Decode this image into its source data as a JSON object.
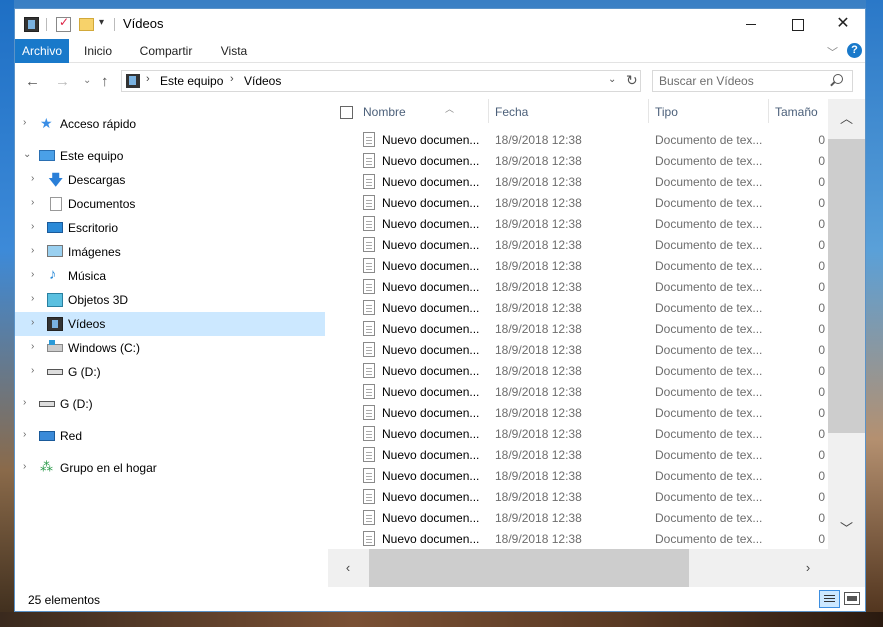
{
  "window": {
    "title": "Vídeos",
    "minimize_label": "",
    "maximize_label": "",
    "close_label": "✕"
  },
  "ribbon": {
    "tabs": [
      "Archivo",
      "Inicio",
      "Compartir",
      "Vista"
    ]
  },
  "address": {
    "crumbs": [
      "Este equipo",
      "Vídeos"
    ],
    "search_placeholder": "Buscar en Vídeos"
  },
  "nav_pane": {
    "items": [
      {
        "label": "Acceso rápido",
        "icon": "star-icon"
      },
      {
        "label": "Este equipo",
        "icon": "computer-icon"
      },
      {
        "label": "Descargas",
        "icon": "download-icon"
      },
      {
        "label": "Documentos",
        "icon": "document-icon"
      },
      {
        "label": "Escritorio",
        "icon": "desktop-icon"
      },
      {
        "label": "Imágenes",
        "icon": "image-icon"
      },
      {
        "label": "Música",
        "icon": "music-icon"
      },
      {
        "label": "Objetos 3D",
        "icon": "3d-objects-icon"
      },
      {
        "label": "Vídeos",
        "icon": "film-icon",
        "selected": true
      },
      {
        "label": "Windows (C:)",
        "icon": "drive-icon"
      },
      {
        "label": "G (D:)",
        "icon": "drive-icon"
      },
      {
        "label": "G (D:)",
        "icon": "drive-icon"
      },
      {
        "label": "Red",
        "icon": "network-icon"
      },
      {
        "label": "Grupo en el hogar",
        "icon": "homegroup-icon"
      }
    ]
  },
  "file_list": {
    "columns": [
      "Nombre",
      "Fecha",
      "Tipo",
      "Tamaño"
    ],
    "rows": [
      {
        "name": "Nuevo documen...",
        "date": "18/9/2018 12:38",
        "type": "Documento de tex...",
        "size": "0"
      },
      {
        "name": "Nuevo documen...",
        "date": "18/9/2018 12:38",
        "type": "Documento de tex...",
        "size": "0"
      },
      {
        "name": "Nuevo documen...",
        "date": "18/9/2018 12:38",
        "type": "Documento de tex...",
        "size": "0"
      },
      {
        "name": "Nuevo documen...",
        "date": "18/9/2018 12:38",
        "type": "Documento de tex...",
        "size": "0"
      },
      {
        "name": "Nuevo documen...",
        "date": "18/9/2018 12:38",
        "type": "Documento de tex...",
        "size": "0"
      },
      {
        "name": "Nuevo documen...",
        "date": "18/9/2018 12:38",
        "type": "Documento de tex...",
        "size": "0"
      },
      {
        "name": "Nuevo documen...",
        "date": "18/9/2018 12:38",
        "type": "Documento de tex...",
        "size": "0"
      },
      {
        "name": "Nuevo documen...",
        "date": "18/9/2018 12:38",
        "type": "Documento de tex...",
        "size": "0"
      },
      {
        "name": "Nuevo documen...",
        "date": "18/9/2018 12:38",
        "type": "Documento de tex...",
        "size": "0"
      },
      {
        "name": "Nuevo documen...",
        "date": "18/9/2018 12:38",
        "type": "Documento de tex...",
        "size": "0"
      },
      {
        "name": "Nuevo documen...",
        "date": "18/9/2018 12:38",
        "type": "Documento de tex...",
        "size": "0"
      },
      {
        "name": "Nuevo documen...",
        "date": "18/9/2018 12:38",
        "type": "Documento de tex...",
        "size": "0"
      },
      {
        "name": "Nuevo documen...",
        "date": "18/9/2018 12:38",
        "type": "Documento de tex...",
        "size": "0"
      },
      {
        "name": "Nuevo documen...",
        "date": "18/9/2018 12:38",
        "type": "Documento de tex...",
        "size": "0"
      },
      {
        "name": "Nuevo documen...",
        "date": "18/9/2018 12:38",
        "type": "Documento de tex...",
        "size": "0"
      },
      {
        "name": "Nuevo documen...",
        "date": "18/9/2018 12:38",
        "type": "Documento de tex...",
        "size": "0"
      },
      {
        "name": "Nuevo documen...",
        "date": "18/9/2018 12:38",
        "type": "Documento de tex...",
        "size": "0"
      },
      {
        "name": "Nuevo documen...",
        "date": "18/9/2018 12:38",
        "type": "Documento de tex...",
        "size": "0"
      },
      {
        "name": "Nuevo documen...",
        "date": "18/9/2018 12:38",
        "type": "Documento de tex...",
        "size": "0"
      },
      {
        "name": "Nuevo documen...",
        "date": "18/9/2018 12:38",
        "type": "Documento de tex...",
        "size": "0"
      }
    ]
  },
  "status": {
    "count_text": "25 elementos"
  },
  "colors": {
    "accent": "#1979ca",
    "selection": "#cce8ff",
    "header_text": "#4c607a",
    "secondary_text": "#6d6d6d"
  }
}
